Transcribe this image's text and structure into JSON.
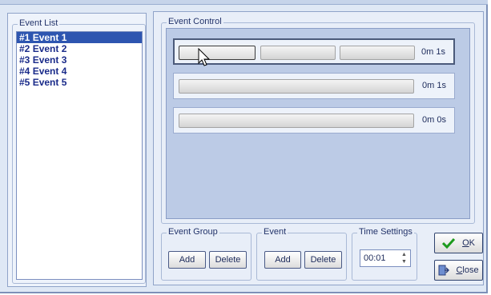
{
  "event_list": {
    "label": "Event List",
    "items": [
      {
        "num": "#1",
        "label": "Event 1",
        "selected": true
      },
      {
        "num": "#2",
        "label": "Event 2",
        "selected": false
      },
      {
        "num": "#3",
        "label": "Event 3",
        "selected": false
      },
      {
        "num": "#4",
        "label": "Event 4",
        "selected": false
      },
      {
        "num": "#5",
        "label": "Event 5",
        "selected": false
      }
    ]
  },
  "event_control": {
    "label": "Event Control",
    "rows": [
      {
        "time": "0m 1s"
      },
      {
        "time": "0m 1s"
      },
      {
        "time": "0m 0s"
      }
    ]
  },
  "event_group": {
    "label": "Event Group",
    "add": "Add",
    "delete": "Delete"
  },
  "event": {
    "label": "Event",
    "add": "Add",
    "delete": "Delete"
  },
  "time_settings": {
    "label": "Time Settings",
    "value": "00:01"
  },
  "buttons": {
    "ok_pre": "",
    "ok_u": "O",
    "ok_post": "K",
    "close_pre": "",
    "close_u": "C",
    "close_post": "lose"
  },
  "colors": {
    "selection": "#2d55b0",
    "ok_check": "#1d9a1d"
  },
  "icons": {
    "ok": "check-icon",
    "close": "exit-door-icon",
    "cursor": "hand-pointer-icon"
  }
}
